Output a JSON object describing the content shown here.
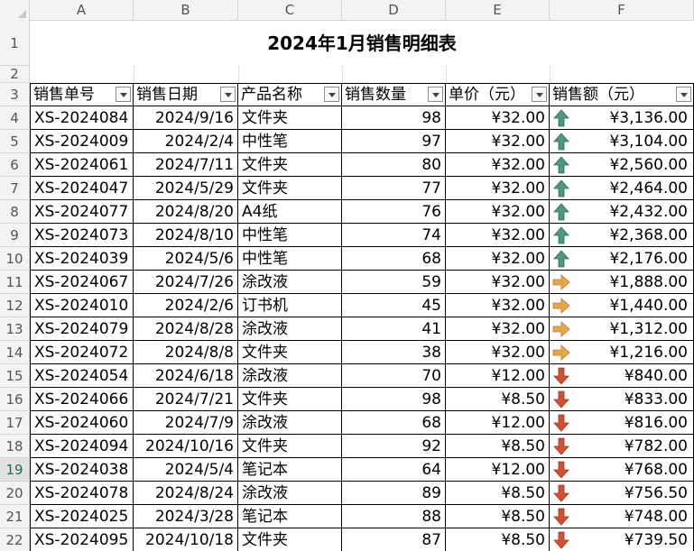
{
  "columns": [
    "A",
    "B",
    "C",
    "D",
    "E",
    "F"
  ],
  "title": "2024年1月销售明细表",
  "headers": [
    "销售单号",
    "销售日期",
    "产品名称",
    "销售数量",
    "单价（元）",
    "销售额（元）"
  ],
  "selected_row": "19",
  "colors": {
    "up": "#4a9a7b",
    "side": "#e8a64a",
    "down": "#d2502f"
  },
  "rows": [
    {
      "num": "4",
      "id": "XS-2024084",
      "date": "2024/9/16",
      "product": "文件夹",
      "qty": "98",
      "price": "¥32.00",
      "trend": "up",
      "amount": "¥3,136.00"
    },
    {
      "num": "5",
      "id": "XS-2024009",
      "date": "2024/2/4",
      "product": "中性笔",
      "qty": "97",
      "price": "¥32.00",
      "trend": "up",
      "amount": "¥3,104.00"
    },
    {
      "num": "6",
      "id": "XS-2024061",
      "date": "2024/7/11",
      "product": "文件夹",
      "qty": "80",
      "price": "¥32.00",
      "trend": "up",
      "amount": "¥2,560.00"
    },
    {
      "num": "7",
      "id": "XS-2024047",
      "date": "2024/5/29",
      "product": "文件夹",
      "qty": "77",
      "price": "¥32.00",
      "trend": "up",
      "amount": "¥2,464.00"
    },
    {
      "num": "8",
      "id": "XS-2024077",
      "date": "2024/8/20",
      "product": "A4纸",
      "qty": "76",
      "price": "¥32.00",
      "trend": "up",
      "amount": "¥2,432.00"
    },
    {
      "num": "9",
      "id": "XS-2024073",
      "date": "2024/8/10",
      "product": "中性笔",
      "qty": "74",
      "price": "¥32.00",
      "trend": "up",
      "amount": "¥2,368.00"
    },
    {
      "num": "10",
      "id": "XS-2024039",
      "date": "2024/5/6",
      "product": "中性笔",
      "qty": "68",
      "price": "¥32.00",
      "trend": "up",
      "amount": "¥2,176.00"
    },
    {
      "num": "11",
      "id": "XS-2024067",
      "date": "2024/7/26",
      "product": "涂改液",
      "qty": "59",
      "price": "¥32.00",
      "trend": "side",
      "amount": "¥1,888.00"
    },
    {
      "num": "12",
      "id": "XS-2024010",
      "date": "2024/2/6",
      "product": "订书机",
      "qty": "45",
      "price": "¥32.00",
      "trend": "side",
      "amount": "¥1,440.00"
    },
    {
      "num": "13",
      "id": "XS-2024079",
      "date": "2024/8/28",
      "product": "涂改液",
      "qty": "41",
      "price": "¥32.00",
      "trend": "side",
      "amount": "¥1,312.00"
    },
    {
      "num": "14",
      "id": "XS-2024072",
      "date": "2024/8/8",
      "product": "文件夹",
      "qty": "38",
      "price": "¥32.00",
      "trend": "side",
      "amount": "¥1,216.00"
    },
    {
      "num": "15",
      "id": "XS-2024054",
      "date": "2024/6/18",
      "product": "涂改液",
      "qty": "70",
      "price": "¥12.00",
      "trend": "down",
      "amount": "¥840.00"
    },
    {
      "num": "16",
      "id": "XS-2024066",
      "date": "2024/7/21",
      "product": "文件夹",
      "qty": "98",
      "price": "¥8.50",
      "trend": "down",
      "amount": "¥833.00"
    },
    {
      "num": "17",
      "id": "XS-2024060",
      "date": "2024/7/9",
      "product": "涂改液",
      "qty": "68",
      "price": "¥12.00",
      "trend": "down",
      "amount": "¥816.00"
    },
    {
      "num": "18",
      "id": "XS-2024094",
      "date": "2024/10/16",
      "product": "文件夹",
      "qty": "92",
      "price": "¥8.50",
      "trend": "down",
      "amount": "¥782.00"
    },
    {
      "num": "19",
      "id": "XS-2024038",
      "date": "2024/5/4",
      "product": "笔记本",
      "qty": "64",
      "price": "¥12.00",
      "trend": "down",
      "amount": "¥768.00"
    },
    {
      "num": "20",
      "id": "XS-2024078",
      "date": "2024/8/24",
      "product": "涂改液",
      "qty": "89",
      "price": "¥8.50",
      "trend": "down",
      "amount": "¥756.50"
    },
    {
      "num": "21",
      "id": "XS-2024025",
      "date": "2024/3/28",
      "product": "笔记本",
      "qty": "88",
      "price": "¥8.50",
      "trend": "down",
      "amount": "¥748.00"
    },
    {
      "num": "22",
      "id": "XS-2024095",
      "date": "2024/10/18",
      "product": "文件夹",
      "qty": "87",
      "price": "¥8.50",
      "trend": "down",
      "amount": "¥739.50"
    }
  ]
}
